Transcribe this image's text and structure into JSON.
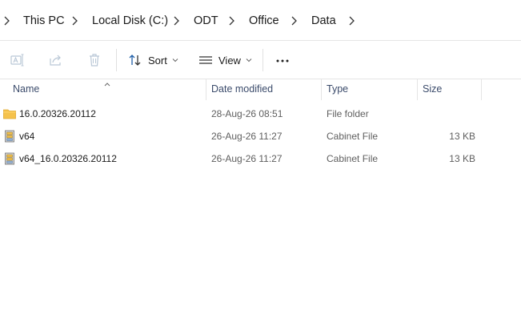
{
  "breadcrumb": {
    "items": [
      "This PC",
      "Local Disk (C:)",
      "ODT",
      "Office",
      "Data"
    ]
  },
  "toolbar": {
    "rename_icon": "rename-icon",
    "share_icon": "share-icon",
    "delete_icon": "trash-icon",
    "sort_label": "Sort",
    "view_label": "View",
    "more_icon": "more-options-icon"
  },
  "columns": {
    "name": "Name",
    "date_modified": "Date modified",
    "type": "Type",
    "size": "Size"
  },
  "files": [
    {
      "name": "16.0.20326.20112",
      "date": "28-Aug-26 08:51",
      "type": "File folder",
      "size": "",
      "icon": "folder-icon"
    },
    {
      "name": "v64",
      "date": "26-Aug-26 11:27",
      "type": "Cabinet File",
      "size": "13 KB",
      "icon": "cabinet-file-icon"
    },
    {
      "name": "v64_16.0.20326.20112",
      "date": "26-Aug-26 11:27",
      "type": "Cabinet File",
      "size": "13 KB",
      "icon": "cabinet-file-icon"
    }
  ],
  "colors": {
    "folder": "#f5c24c",
    "header_text": "#3b4b6b",
    "disabled_icon": "#b9c7d6"
  }
}
